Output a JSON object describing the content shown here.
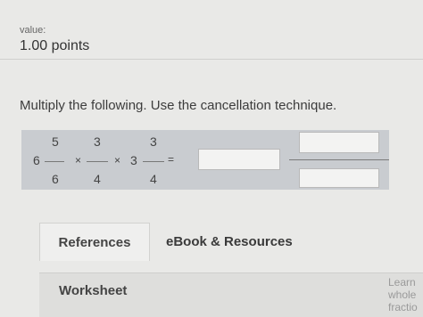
{
  "header": {
    "value_label": "value:",
    "points": "1.00 points"
  },
  "question": {
    "prompt": "Multiply the following. Use the cancellation technique."
  },
  "problem": {
    "term1_whole": "6",
    "term1_numerator": "5",
    "term1_denominator": "6",
    "op1": "×",
    "term2_numerator": "3",
    "term2_denominator": "4",
    "op2": "×",
    "term3_whole": "3",
    "term3_numerator": "3",
    "term3_denominator": "4",
    "equals": "="
  },
  "answer": {
    "whole_value": "",
    "numerator_value": "",
    "denominator_value": ""
  },
  "tabs": {
    "references": "References",
    "ebook": "eBook & Resources"
  },
  "panel": {
    "worksheet": "Worksheet",
    "side_line1": "Learn",
    "side_line2": "whole",
    "side_line3": "fractio"
  }
}
